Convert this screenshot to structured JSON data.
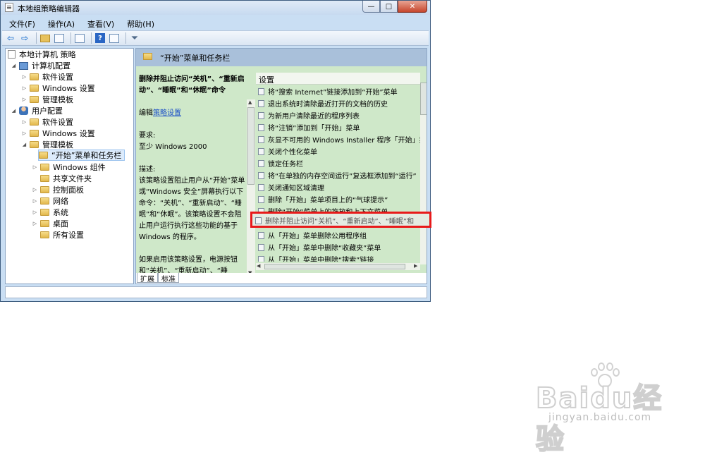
{
  "window": {
    "title": "本地组策略编辑器",
    "controls": {
      "minimize": "—",
      "maximize": "□",
      "close": "✕"
    }
  },
  "menu": [
    "文件(F)",
    "操作(A)",
    "查看(V)",
    "帮助(H)"
  ],
  "toolbar_icons": [
    "back-arrow-icon",
    "forward-arrow-icon",
    "up-folder-icon",
    "show-hide-tree-icon",
    "export-list-icon",
    "help-icon",
    "properties-icon",
    "filter-icon"
  ],
  "tree": {
    "root": "本地计算机 策略",
    "computer_config": "计算机配置",
    "cc_software": "软件设置",
    "cc_windows": "Windows 设置",
    "cc_admin": "管理模板",
    "user_config": "用户配置",
    "uc_software": "软件设置",
    "uc_windows": "Windows 设置",
    "uc_admin": "管理模板",
    "start_menu": "“开始”菜单和任务栏",
    "win_components": "Windows 组件",
    "shared_folders": "共享文件夹",
    "control_panel": "控制面板",
    "network": "网络",
    "system": "系统",
    "desktop": "桌面",
    "all_settings": "所有设置"
  },
  "right": {
    "header": "“开始”菜单和任务栏",
    "desc_title": "删除并阻止访问“关机”、“重新启动”、“睡眠”和“休眠”命令",
    "edit_prefix": "编辑",
    "edit_link": "策略设置",
    "req_label": "要求:",
    "req_value": "至少 Windows 2000",
    "desc_label": "描述:",
    "desc_body": "该策略设置阻止用户从“开始”菜单或“Windows 安全”屏幕执行以下命令：“关机”、“重新启动”、“睡眠”和“休眠”。该策略设置不会阻止用户运行执行这些功能的基于 Windows 的程序。",
    "desc_more": "如果启用该策略设置，电源按钮和“关机”、“重新启动”、“睡眠”和“休眠”命令将从“开始”",
    "list_header": "设置",
    "items": [
      "将“搜索 Internet”链接添加到“开始”菜单",
      "退出系统时清除最近打开的文档的历史",
      "为新用户清除最近的程序列表",
      "将“注销”添加到「开始」菜单",
      "灰显不可用的 Windows Installer 程序「开始」菜",
      "关闭个性化菜单",
      "锁定任务栏",
      "将“在单独的内存空间运行”复选框添加到“运行”",
      "关闭通知区域清理",
      "删除「开始」菜单项目上的“气球提示”",
      "删除“开始”菜单上的拖放和上下文菜单"
    ],
    "items_after": [
      "从「开始」菜单删除公用程序组",
      "从「开始」菜单中删除“收藏夹”菜单",
      "从「开始」菜单中删除“搜索”链接"
    ],
    "highlighted_item": "删除并阻止访问“关机”、“重新启动”、“睡眠”和",
    "tab_extended": "扩展",
    "tab_standard": "标准"
  },
  "watermark": {
    "brand": "Baidu经验",
    "url": "jingyan.baidu.com"
  }
}
